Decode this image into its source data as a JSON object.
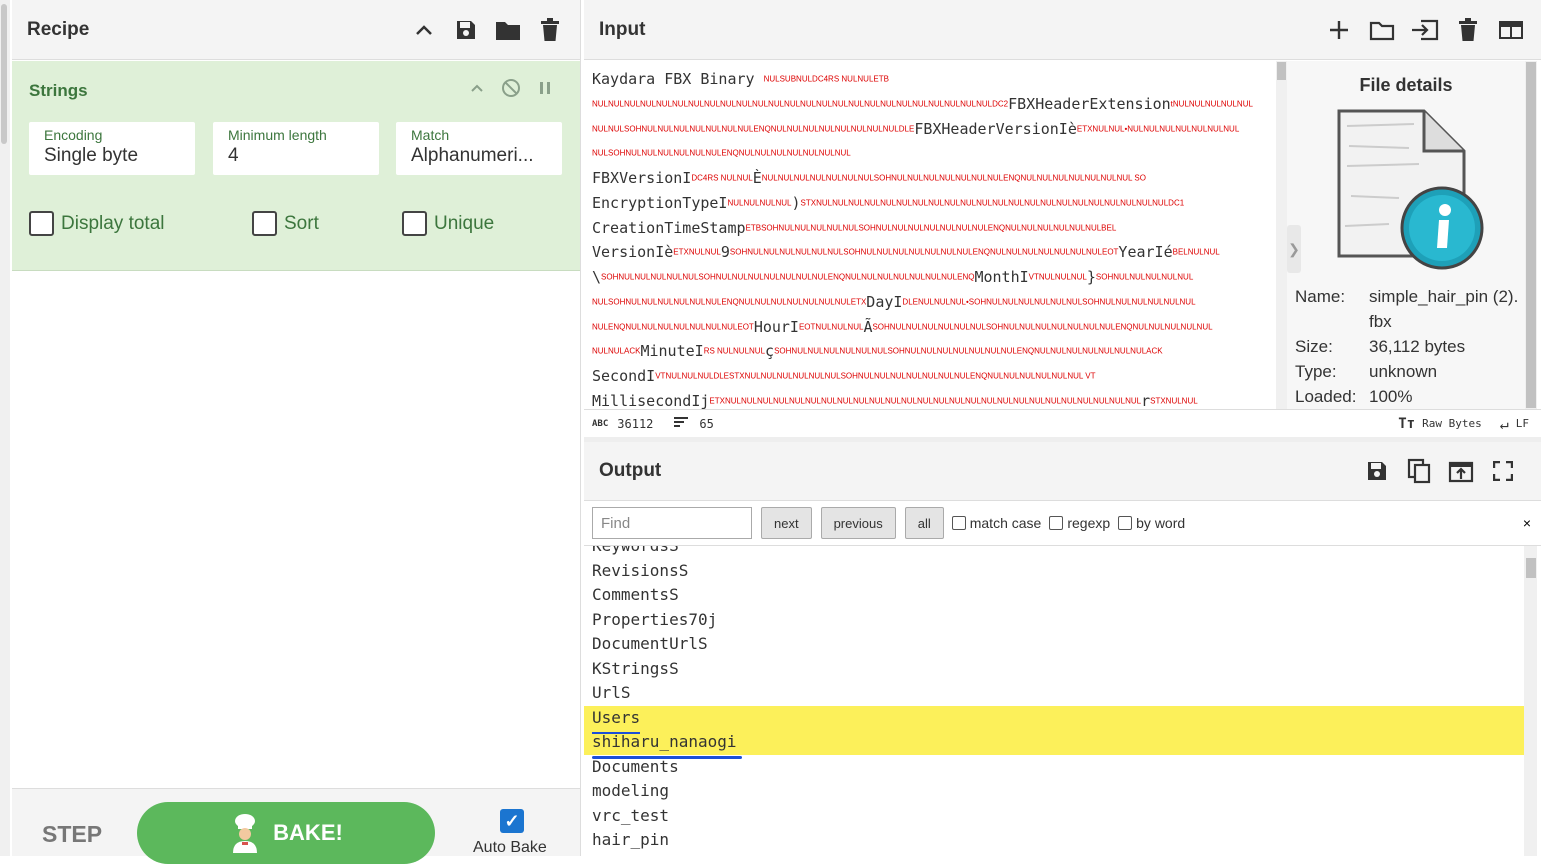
{
  "recipe": {
    "title": "Recipe",
    "operation": {
      "name": "Strings",
      "encoding": {
        "label": "Encoding",
        "value": "Single byte"
      },
      "min_length": {
        "label": "Minimum length",
        "value": "4"
      },
      "match": {
        "label": "Match",
        "value": "Alphanumeri..."
      },
      "display_total": "Display total",
      "sort": "Sort",
      "unique": "Unique"
    }
  },
  "controls": {
    "step": "STEP",
    "bake": "BAKE!",
    "auto_bake": "Auto Bake",
    "auto_bake_checked": true
  },
  "input": {
    "title": "Input",
    "lines": [
      [
        [
          "t",
          "Kaydara FBX Binary  "
        ],
        [
          "c",
          "NULSUBNULDC4RS NULNULETB"
        ]
      ],
      [
        [
          "c",
          "NULNULNULNULNULNULNULNULNULNULNULNULNULNULNULNULNULNULNULNULNULNULNULNULNULDC2"
        ],
        [
          "t",
          "FBXHeaderExtension"
        ],
        [
          "c",
          "tNULNULNULNULNUL"
        ]
      ],
      [
        [
          "c",
          "NULNULSOHNULNULNULNULNULNULNULENQNULNULNULNULNULNULNULNULDLE"
        ],
        [
          "t",
          "FBXHeaderVersionIè"
        ],
        [
          "c",
          "ETXNULNUL•NULNULNULNULNULNULNUL"
        ]
      ],
      [
        [
          "c",
          "NULSOHNULNULNULNULNULNULENQNULNULNULNULNULNULNUL"
        ]
      ],
      [
        [
          "t",
          "FBXVersionI"
        ],
        [
          "c",
          "DC4RS NULNUL"
        ],
        [
          "t",
          "È"
        ],
        [
          "c",
          "NULNULNULNULNULNULNULSOHNULNULNULNULNULNULNULENQNULNULNULNULNULNULNUL SO"
        ]
      ],
      [
        [
          "t",
          "EncryptionTypeI"
        ],
        [
          "c",
          "NULNULNULNUL"
        ],
        [
          "t",
          ")"
        ],
        [
          "c",
          "STXNULNULNULNULNULNULNULNULNULNULNULNULNULNULNULNULNULNULNULNULNULNULDC1"
        ]
      ],
      [
        [
          "t",
          "CreationTimeStamp"
        ],
        [
          "c",
          "ETBSOHNULNULNULNULNULSOHNULNULNULNULNULNULNULENQNULNULNULNULNULNULBEL"
        ]
      ],
      [
        [
          "t",
          "VersionIè"
        ],
        [
          "c",
          "ETXNULNUL"
        ],
        [
          "t",
          "9"
        ],
        [
          "c",
          "SOHNULNULNULNULNULNULSOHNULNULNULNULNULNULNULENQNULNULNULNULNULNULNULEOT"
        ],
        [
          "t",
          "YearIé"
        ],
        [
          "c",
          "BELNULNUL"
        ]
      ],
      [
        [
          "t",
          "\\"
        ],
        [
          "c",
          "SOHNULNULNULNULNULSOHNULNULNULNULNULNULNULENQNULNULNULNULNULNULNULENQ"
        ],
        [
          "t",
          "MonthI"
        ],
        [
          "c",
          "VTNULNULNUL"
        ],
        [
          "t",
          "}"
        ],
        [
          "c",
          "SOHNULNULNULNULNUL"
        ]
      ],
      [
        [
          "c",
          "NULSOHNULNULNULNULNULNULENQNULNULNULNULNULNULNULETX"
        ],
        [
          "t",
          "DayI"
        ],
        [
          "c",
          "DLENULNULNUL•SOHNULNULNULNULNULNULSOHNULNULNULNULNULNUL"
        ]
      ],
      [
        [
          "c",
          "NULENQNULNULNULNULNULNULNULEOT"
        ],
        [
          "t",
          "HourI"
        ],
        [
          "c",
          "EOTNULNULNUL"
        ],
        [
          "t",
          "Ã"
        ],
        [
          "c",
          "SOHNULNULNULNULNULNULSOHNULNULNULNULNULNULNULENQNULNULNULNULNUL"
        ]
      ],
      [
        [
          "c",
          "NULNULACK"
        ],
        [
          "t",
          "MinuteI"
        ],
        [
          "c",
          "RS NULNULNUL"
        ],
        [
          "t",
          "ç"
        ],
        [
          "c",
          "SOHNULNULNULNULNULNULSOHNULNULNULNULNULNULNULENQNULNULNULNULNULNULNULACK"
        ]
      ],
      [
        [
          "t",
          "SecondI"
        ],
        [
          "c",
          "VTNULNULNULDLESTXNULNULNULNULNULNULSOHNULNULNULNULNULNULNULENQNULNULNULNULNULNUL VT"
        ]
      ],
      [
        [
          "t",
          "MillisecondIj"
        ],
        [
          "c",
          "ETXNULNULNULNULNULNULNULNULNULNULNULNULNULNULNULNULNULNULNULNULNULNULNULNULNULNUL"
        ],
        [
          "t",
          "r"
        ],
        [
          "c",
          "STXNULNUL"
        ]
      ]
    ],
    "status": {
      "chars": "36112",
      "lines": "65",
      "encoding": "Raw Bytes",
      "eol": "LF"
    }
  },
  "file_details": {
    "title": "File details",
    "name_label": "Name:",
    "name_value": "simple_hair_pin (2).",
    "name_value2": "fbx",
    "size_label": "Size:",
    "size_value": "36,112 bytes",
    "type_label": "Type:",
    "type_value": "unknown",
    "loaded_label": "Loaded:",
    "loaded_value": "100%"
  },
  "output": {
    "title": "Output",
    "find": {
      "placeholder": "Find",
      "next": "next",
      "previous": "previous",
      "all": "all",
      "match_case": "match case",
      "regexp": "regexp",
      "by_word": "by word",
      "close": "×"
    },
    "lines": [
      "KeywordsS",
      "RevisionsS",
      "CommentsS",
      "Properties70j",
      "DocumentUrlS",
      "KStringsS",
      "UrlS",
      "Users",
      "shiharu_nanaogi",
      "Documents",
      "modeling",
      "vrc_test",
      "hair_pin"
    ]
  }
}
